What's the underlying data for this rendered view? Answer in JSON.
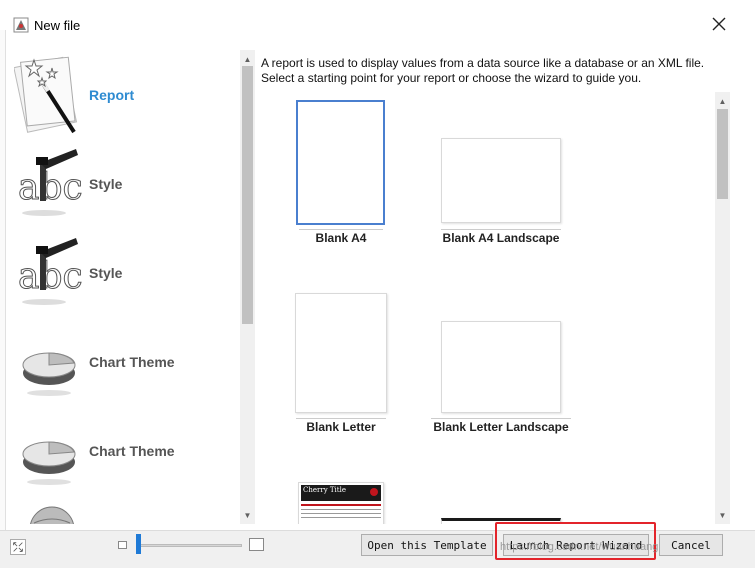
{
  "window": {
    "title": "New file"
  },
  "types": [
    {
      "label": "Report",
      "icon": "report-wand-icon",
      "selected": true
    },
    {
      "label": "Style",
      "icon": "style-brush-abc-icon",
      "selected": false
    },
    {
      "label": "Style",
      "icon": "style-brush-abc-icon",
      "selected": false
    },
    {
      "label": "Chart Theme",
      "icon": "pie-chart-icon",
      "selected": false
    },
    {
      "label": "Chart Theme",
      "icon": "pie-chart-icon",
      "selected": false
    }
  ],
  "description": "A report is used to display values from a data source like a database or an XML file. Select a starting point for your report or choose the wizard to guide you.",
  "templates": [
    {
      "label": "Blank A4",
      "selected": true
    },
    {
      "label": "Blank A4 Landscape",
      "selected": false
    },
    {
      "label": "Blank Letter",
      "selected": false
    },
    {
      "label": "Blank Letter Landscape",
      "selected": false
    },
    {
      "label": "Cherry Title",
      "selected": false
    },
    {
      "label": "",
      "selected": false
    }
  ],
  "buttons": {
    "open_template": "Open this Template",
    "launch_wizard": "Launch Report Wizard",
    "cancel": "Cancel"
  },
  "colors": {
    "selected_text": "#2e8bd1",
    "selection_border": "#4a7fcf",
    "highlight": "#e3242b",
    "cherry": "#c0151d"
  },
  "watermark": "https://blog.csdn.net/wuanhuang"
}
